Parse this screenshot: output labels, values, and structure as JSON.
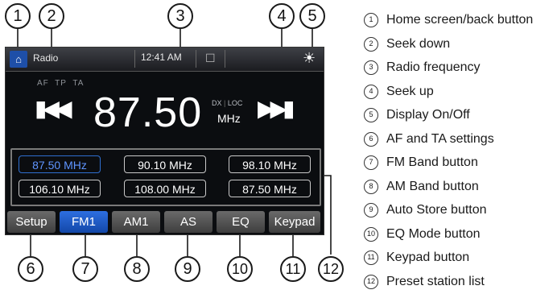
{
  "statusbar": {
    "title": "Radio",
    "time": "12:41 AM"
  },
  "radio": {
    "af": "AF",
    "tp": "TP",
    "ta": "TA",
    "frequency": "87.50",
    "dx": "DX",
    "loc": "LOC",
    "unit": "MHz",
    "presets": [
      "87.50 MHz",
      "90.10 MHz",
      "98.10 MHz",
      "106.10 MHz",
      "108.00 MHz",
      "87.50 MHz"
    ],
    "active_preset_index": 0
  },
  "bands": [
    "Setup",
    "FM1",
    "AM1",
    "AS",
    "EQ",
    "Keypad"
  ],
  "active_band_index": 1,
  "callouts": [
    "1",
    "2",
    "3",
    "4",
    "5",
    "6",
    "7",
    "8",
    "9",
    "10",
    "11",
    "12"
  ],
  "legend": [
    {
      "num": "1",
      "label": "Home screen/back button"
    },
    {
      "num": "2",
      "label": "Seek down"
    },
    {
      "num": "3",
      "label": "Radio frequency"
    },
    {
      "num": "4",
      "label": "Seek up"
    },
    {
      "num": "5",
      "label": "Display On/Off"
    },
    {
      "num": "6",
      "label": "AF and TA settings"
    },
    {
      "num": "7",
      "label": "FM Band button"
    },
    {
      "num": "8",
      "label": "AM Band button"
    },
    {
      "num": "9",
      "label": "Auto Store button"
    },
    {
      "num": "10",
      "label": "EQ Mode button"
    },
    {
      "num": "11",
      "label": "Keypad button"
    },
    {
      "num": "12",
      "label": "Preset station list"
    }
  ],
  "icons": {
    "home": "home-icon",
    "seek_down": "skip-back-icon",
    "seek_up": "skip-forward-icon",
    "display": "sun-icon",
    "phone": "phone-icon"
  },
  "colors": {
    "accent_blue": "#1e4fa8",
    "active_preset": "#5f95ff",
    "screen_bg": "#0b0d10"
  }
}
